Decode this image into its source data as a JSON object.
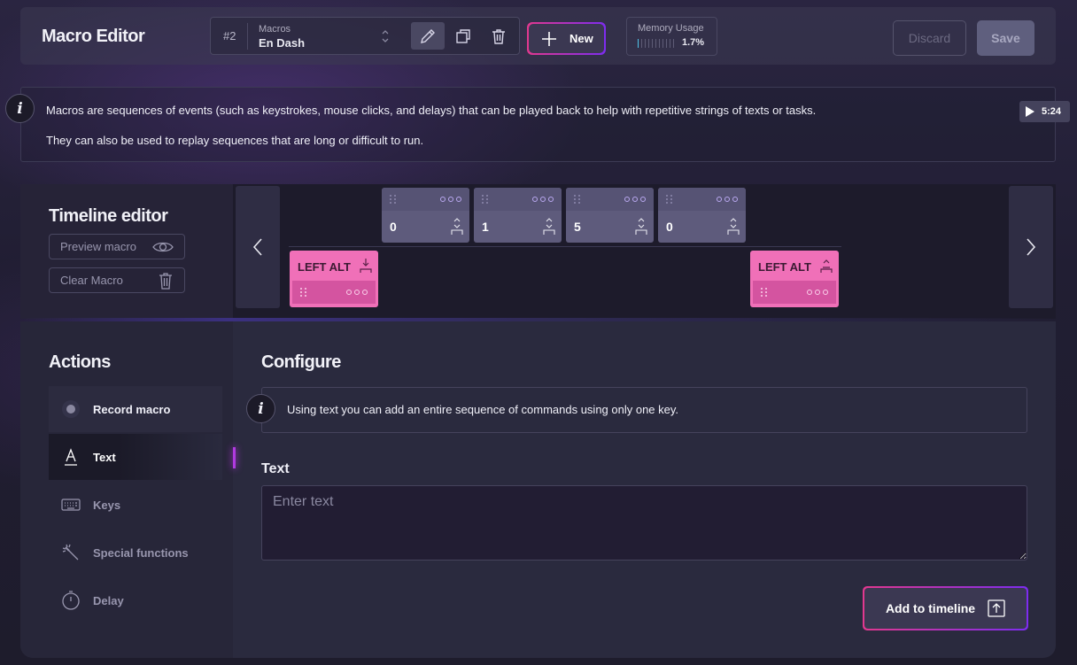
{
  "header": {
    "title": "Macro Editor",
    "macro_number": "#2",
    "macro_label": "Macros",
    "macro_name": "En Dash",
    "new_label": "New",
    "memory_label": "Memory Usage",
    "memory_value": "1.7%",
    "memory_fraction": 0.017,
    "discard_label": "Discard",
    "save_label": "Save"
  },
  "info": {
    "line1": "Macros are sequences of events (such as keystrokes, mouse clicks, and delays) that can be played back to help with repetitive strings of texts or tasks.",
    "line2": "They can also be used to replay sequences that are long or difficult to run.",
    "video_duration": "5:24"
  },
  "timeline": {
    "title": "Timeline editor",
    "preview_label": "Preview macro",
    "clear_label": "Clear Macro",
    "key_cards": [
      {
        "value": "0"
      },
      {
        "value": "1"
      },
      {
        "value": "5"
      },
      {
        "value": "0"
      }
    ],
    "modifier_cards": [
      {
        "label": "LEFT ALT",
        "state": "press"
      },
      {
        "label": "LEFT ALT",
        "state": "release"
      }
    ]
  },
  "actions": {
    "title": "Actions",
    "items": [
      {
        "label": "Record macro",
        "icon": "record-icon"
      },
      {
        "label": "Text",
        "icon": "text-icon"
      },
      {
        "label": "Keys",
        "icon": "keyboard-icon"
      },
      {
        "label": "Special functions",
        "icon": "magic-wand-icon"
      },
      {
        "label": "Delay",
        "icon": "stopwatch-icon"
      }
    ],
    "selected": "Text"
  },
  "configure": {
    "title": "Configure",
    "info_text": "Using text you can add an entire sequence of commands using only one key.",
    "text_label": "Text",
    "text_placeholder": "Enter text",
    "text_value": "",
    "add_label": "Add to timeline"
  },
  "colors": {
    "accent_pink": "#e2388f",
    "accent_purple": "#7d2cf0",
    "modifier_card": "#f070b8",
    "key_card": "#5e5b7c"
  }
}
